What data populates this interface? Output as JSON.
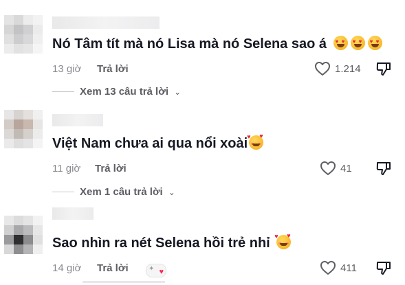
{
  "comments": [
    {
      "text": "Nó Tâm tít mà nó Lisa mà nó Selena sao á",
      "emojis": [
        "heart-eyes-emoji",
        "heart-eyes-emoji",
        "heart-eyes-emoji"
      ],
      "time": "13 giờ",
      "reply_label": "Trả lời",
      "likes": "1.214",
      "view_replies": "Xem 13 câu trả lời"
    },
    {
      "text": "Việt Nam chưa ai qua nổi xoài",
      "emojis": [
        "smiling-face-with-hearts-emoji"
      ],
      "time": "11 giờ",
      "reply_label": "Trả lời",
      "likes": "41",
      "view_replies": "Xem 1 câu trả lời"
    },
    {
      "text": "Sao nhìn ra nét Selena hồi trẻ nhỉ",
      "emojis": [
        "smiling-face-with-hearts-emoji"
      ],
      "time": "14 giờ",
      "reply_label": "Trả lời",
      "likes": "411"
    }
  ],
  "colors": {
    "text": "#161823",
    "meta": "#8a8b91",
    "secondary": "#5c5d63",
    "like_heart": "#fe2c55"
  }
}
